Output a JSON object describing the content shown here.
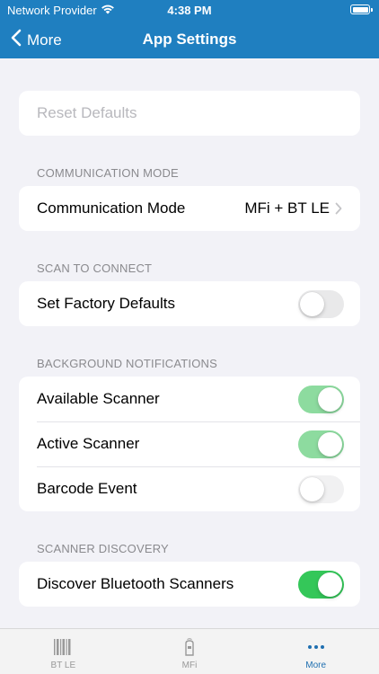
{
  "status_bar": {
    "carrier": "Network Provider",
    "time": "4:38 PM"
  },
  "nav": {
    "back_label": "More",
    "title": "App Settings"
  },
  "reset": {
    "label": "Reset Defaults"
  },
  "communication": {
    "header": "COMMUNICATION MODE",
    "row_label": "Communication Mode",
    "row_value": "MFi + BT LE"
  },
  "scan_to_connect": {
    "header": "SCAN TO CONNECT",
    "factory_label": "Set Factory Defaults",
    "factory_on": false
  },
  "background_notifications": {
    "header": "BACKGROUND NOTIFICATIONS",
    "items": [
      {
        "label": "Available Scanner",
        "on": true
      },
      {
        "label": "Active Scanner",
        "on": true
      },
      {
        "label": "Barcode Event",
        "on": false
      }
    ]
  },
  "scanner_discovery": {
    "header": "SCANNER DISCOVERY",
    "discover_label": "Discover Bluetooth Scanners",
    "discover_on": true
  },
  "tabbar": {
    "tabs": [
      {
        "label": "BT LE",
        "icon": "barcode-icon",
        "active": false
      },
      {
        "label": "MFi",
        "icon": "scanner-device-icon",
        "active": false
      },
      {
        "label": "More",
        "icon": "more-dots-icon",
        "active": true
      }
    ]
  },
  "colors": {
    "nav_background": "#1f7fc0",
    "toggle_on": "#34c759",
    "tab_active": "#1f6fb0"
  }
}
